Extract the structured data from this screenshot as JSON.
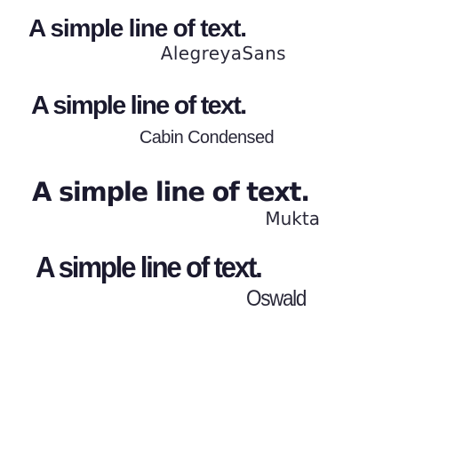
{
  "samples": [
    {
      "text": "A simple line of text.",
      "font_name": "AlegreyaSans"
    },
    {
      "text": "A simple line of text.",
      "font_name": "Cabin Condensed"
    },
    {
      "text": "A simple line of text.",
      "font_name": "Mukta"
    },
    {
      "text": "A simple line of text.",
      "font_name": "Oswald"
    }
  ],
  "colors": {
    "background": "#ffffff",
    "text": "#1b1a2e"
  }
}
